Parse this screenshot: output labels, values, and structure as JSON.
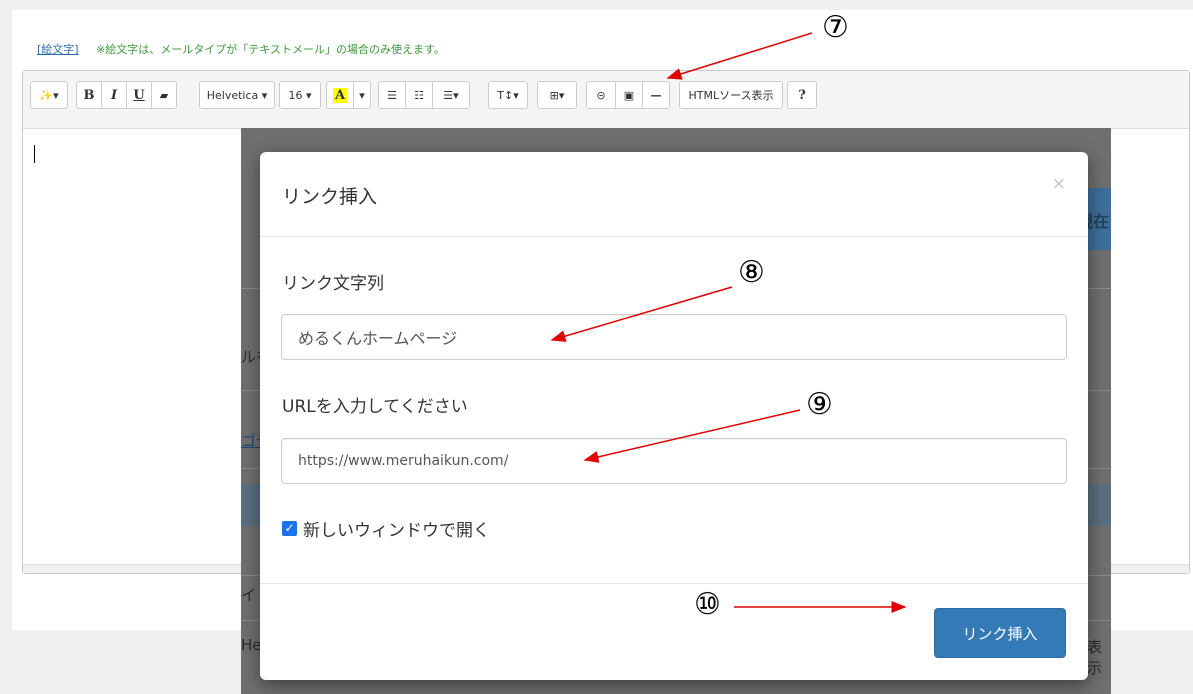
{
  "emoji_note": {
    "link_label": "[絵文字]",
    "note": "※絵文字は、メールタイプが「テキストメール」の場合のみ使えます。"
  },
  "toolbar": {
    "magic_label": "✨▾",
    "bold": "B",
    "italic": "I",
    "underline": "U",
    "eraser": "▰",
    "font_family": "Helvetica ▾",
    "font_size": "16 ▾",
    "color_letter": "A",
    "color_caret": "▾",
    "ul": "☰",
    "ol": "☷",
    "align": "☰▾",
    "line_height": "T↕▾",
    "table": "⊞▾",
    "link": "⊝",
    "image": "▣",
    "hr": "—",
    "html_source": "HTMLソース表示",
    "help": "?"
  },
  "background": {
    "partial_right_button": "現在",
    "partial_left_text_1": "ルを",
    "partial_left_text_2": "ゴデ",
    "partial_left_text_3": "イ",
    "partial_left_text_4": "He",
    "partial_right_text": "表示"
  },
  "modal": {
    "title": "リンク挿入",
    "close": "×",
    "link_text_label": "リンク文字列",
    "link_text_value": "めるくんホームページ",
    "url_label": "URLを入力してください",
    "url_value": "https://www.meruhaikun.com/",
    "new_window_label": "新しいウィンドウで開く",
    "new_window_checked": true,
    "submit": "リンク挿入"
  },
  "annotations": {
    "m7": "⑦",
    "m8": "⑧",
    "m9": "⑨",
    "m10": "⑩",
    "arrow_color": "#e00000"
  }
}
